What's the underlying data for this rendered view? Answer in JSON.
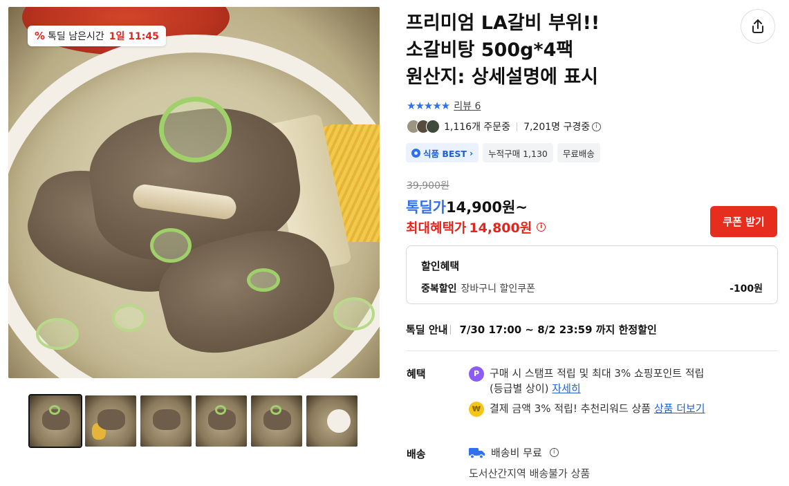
{
  "timer_badge": {
    "label": "톡딜 남은시간",
    "time": "1일 11:45"
  },
  "thumbnails": [
    {
      "name": "thumbnail-1",
      "active": true
    },
    {
      "name": "thumbnail-2",
      "active": false
    },
    {
      "name": "thumbnail-3",
      "active": false
    },
    {
      "name": "thumbnail-4",
      "active": false
    },
    {
      "name": "thumbnail-5",
      "active": false
    },
    {
      "name": "thumbnail-6",
      "active": false
    }
  ],
  "product": {
    "title": "프리미엄 LA갈비 부위!!\n소갈비탕 500g*4팩\n원산지: 상세설명에 표시"
  },
  "rating": {
    "stars": 5,
    "review_label": "리뷰 6"
  },
  "buyers": {
    "ordering": "1,116개 주문중",
    "viewing": "7,201명 구경중"
  },
  "tags": {
    "best": "식품 BEST",
    "cumulative": "누적구매 1,130",
    "free_shipping": "무료배송"
  },
  "price": {
    "original": "39,900원",
    "deal_label": "톡딜가",
    "deal_value": "14,900원~",
    "max_label": "최대혜택가",
    "max_value": "14,800원"
  },
  "coupon_button": "쿠폰 받기",
  "discount": {
    "header": "할인혜택",
    "row_key": "중복할인",
    "row_value": "장바구니 할인쿠폰",
    "row_amount": "-100원"
  },
  "deal_info": {
    "label": "톡딜 안내",
    "value": "7/30 17:00 ~ 8/2 23:59 까지 한정할인"
  },
  "benefits": {
    "label": "혜택",
    "stamp_text": "구매 시 스탬프 적립 및 최대 3% 쇼핑포인트 적립",
    "stamp_text2": "(등급별 상이)",
    "stamp_link": "자세히",
    "reward_text": "결제 금액 3% 적립! 추천리워드 상품",
    "reward_link": "상품 더보기"
  },
  "shipping": {
    "label": "배송",
    "fee": "배송비 무료",
    "note": "도서산간지역 배송불가 상품"
  },
  "colors": {
    "accent_blue": "#2f6ff0",
    "accent_red": "#e3261d"
  }
}
